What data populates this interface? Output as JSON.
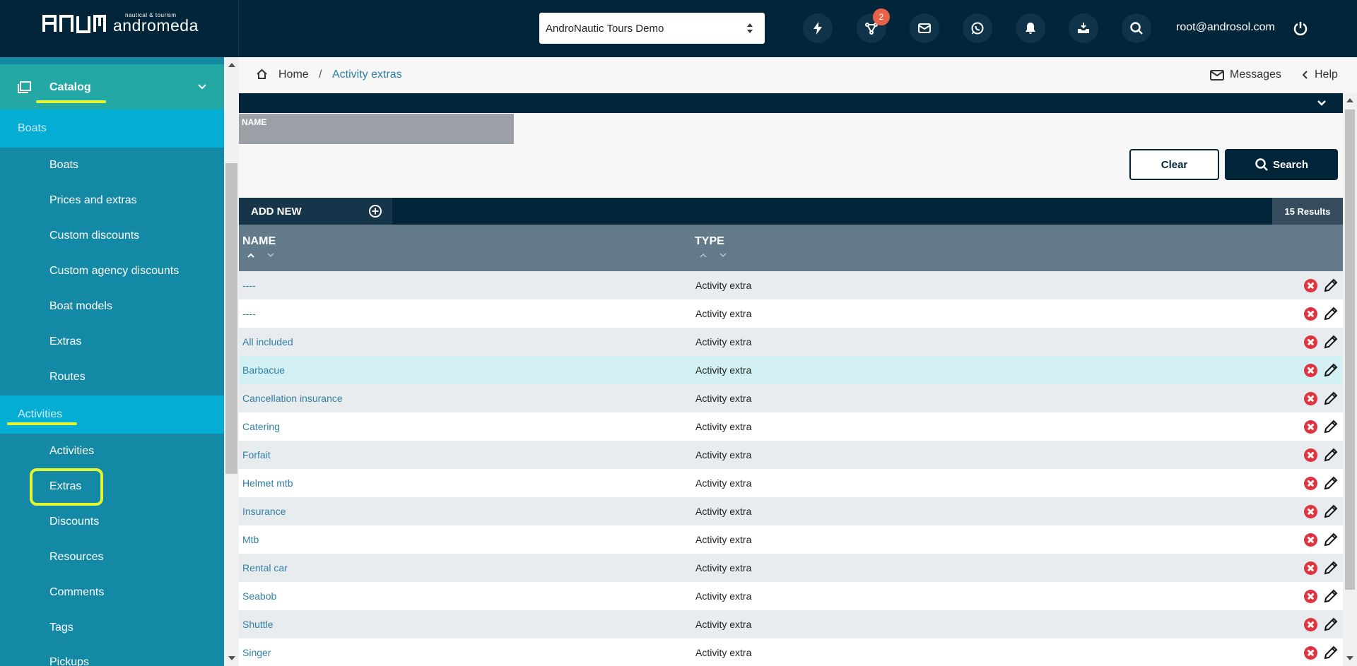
{
  "header": {
    "logo_small": "nautical & tourism",
    "logo_name": "andromeda",
    "company_select": "AndroNautic Tours Demo",
    "badge_count": "2",
    "user_email": "root@androsol.com",
    "icons": [
      "lightning-icon",
      "network-icon",
      "mail-icon",
      "whatsapp-icon",
      "bell-icon",
      "inbox-icon",
      "search-icon",
      "power-icon"
    ]
  },
  "sidebar": {
    "catalog": "Catalog",
    "boats_section": "Boats",
    "boats_items": [
      "Boats",
      "Prices and extras",
      "Custom discounts",
      "Custom agency discounts",
      "Boat models",
      "Extras",
      "Routes"
    ],
    "activities_section": "Activities",
    "activities_items": [
      "Activities",
      "Extras",
      "Discounts",
      "Resources",
      "Comments",
      "Tags",
      "Pickups"
    ],
    "highlight_color": "#e4f531"
  },
  "breadcrumb": {
    "home": "Home",
    "separator": "/",
    "current": "Activity extras",
    "messages": "Messages",
    "help": "Help"
  },
  "filter": {
    "name_label": "NAME",
    "clear": "Clear",
    "search": "Search"
  },
  "table": {
    "add_new": "ADD NEW",
    "results": "15 Results",
    "columns": [
      "NAME",
      "TYPE"
    ],
    "rows": [
      {
        "name": "----",
        "type": "Activity extra"
      },
      {
        "name": "----",
        "type": "Activity extra"
      },
      {
        "name": "All included",
        "type": "Activity extra"
      },
      {
        "name": "Barbacue",
        "type": "Activity extra"
      },
      {
        "name": "Cancellation insurance",
        "type": "Activity extra"
      },
      {
        "name": "Catering",
        "type": "Activity extra"
      },
      {
        "name": "Forfait",
        "type": "Activity extra"
      },
      {
        "name": "Helmet mtb",
        "type": "Activity extra"
      },
      {
        "name": "Insurance",
        "type": "Activity extra"
      },
      {
        "name": "Mtb",
        "type": "Activity extra"
      },
      {
        "name": "Rental car",
        "type": "Activity extra"
      },
      {
        "name": "Seabob",
        "type": "Activity extra"
      },
      {
        "name": "Shuttle",
        "type": "Activity extra"
      },
      {
        "name": "Singer",
        "type": "Activity extra"
      }
    ]
  },
  "colors": {
    "navy": "#03253a",
    "sidebar": "#1389a6",
    "catalog": "#23a8a6",
    "section": "#04add3",
    "link": "#2f7fa5",
    "delete": "#e0333d",
    "row_hover": "#d3f0f5",
    "row_alt": "#e9ecef"
  }
}
